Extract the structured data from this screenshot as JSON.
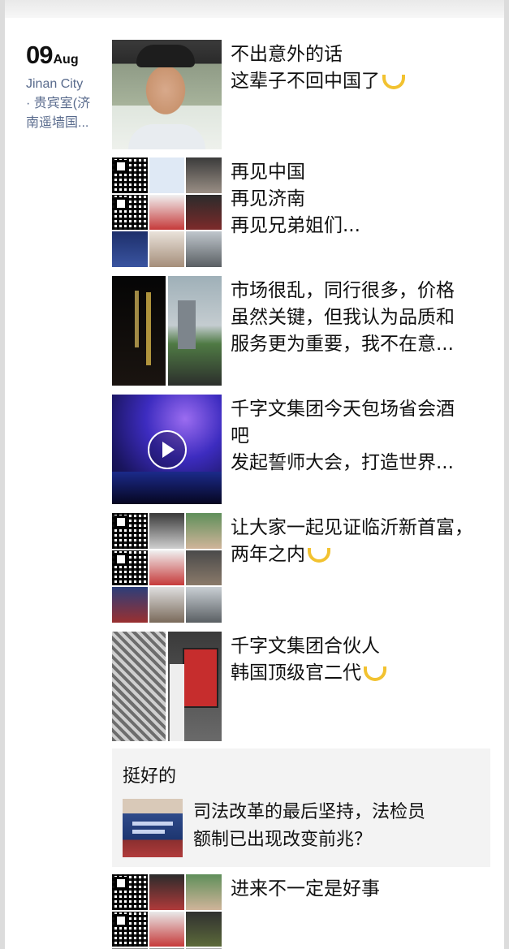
{
  "date": {
    "day": "09",
    "month": "Aug",
    "location_lines": [
      "Jinan City",
      "· 贵宾室(济",
      "南遥墙国..."
    ]
  },
  "posts": [
    {
      "lines": [
        "不出意外的话",
        "这辈子不回中国了"
      ],
      "banana": [
        false,
        true
      ],
      "thumb": "selfie-photo"
    },
    {
      "lines": [
        "再见中国",
        "再见济南",
        "再见兄弟姐们..."
      ],
      "banana": [
        false,
        false,
        false
      ],
      "thumb": "photo-grid"
    },
    {
      "lines": [
        "市场很乱，同行很多，价格",
        "虽然关键，但我认为品质和",
        "服务更为重要，我不在意..."
      ],
      "banana": [
        false,
        false,
        false
      ],
      "thumb": "building-photos"
    },
    {
      "lines": [
        "千字文集团今天包场省会酒",
        "吧",
        "发起誓师大会，打造世界..."
      ],
      "banana": [
        false,
        false,
        false
      ],
      "thumb": "video-concert"
    },
    {
      "lines": [
        "让大家一起见证临沂新首富，",
        "两年之内"
      ],
      "banana": [
        false,
        true
      ],
      "thumb": "photo-grid"
    },
    {
      "lines": [
        "千字文集团合伙人",
        "韩国顶级官二代"
      ],
      "banana": [
        false,
        true
      ],
      "thumb": "office-photos"
    },
    {
      "lines": [
        "进来不一定是好事"
      ],
      "banana": [
        false
      ],
      "thumb": "photo-grid"
    }
  ],
  "share": {
    "comment": "挺好的",
    "title_lines": [
      "司法改革的最后坚持，法检员",
      "额制已出现改变前兆？"
    ]
  },
  "icons": {
    "play": "play-icon",
    "emoji": "banana-emoji-icon"
  }
}
